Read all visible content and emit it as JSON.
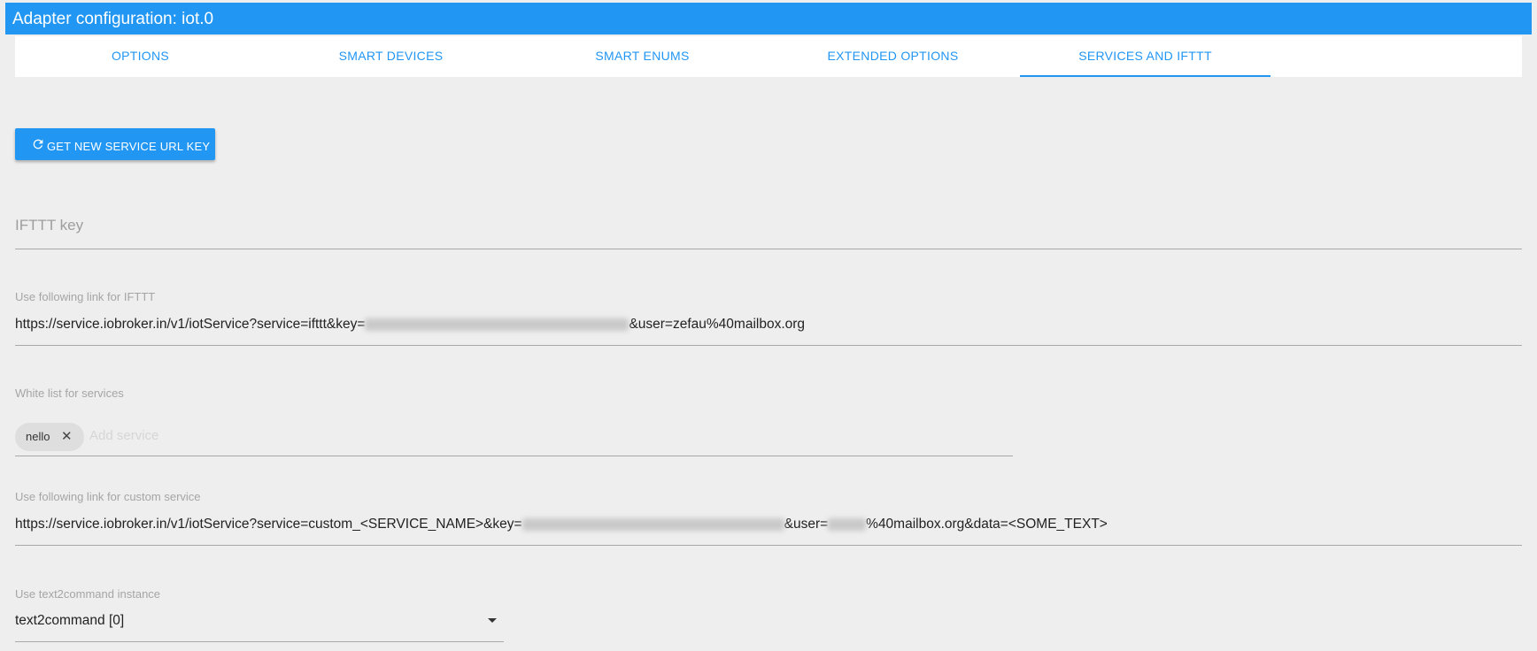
{
  "window": {
    "title": "Adapter configuration: iot.0"
  },
  "tabs": [
    {
      "label": "OPTIONS"
    },
    {
      "label": "SMART DEVICES"
    },
    {
      "label": "SMART ENUMS"
    },
    {
      "label": "EXTENDED OPTIONS"
    },
    {
      "label": "SERVICES AND IFTTT",
      "active": true
    }
  ],
  "refresh_button": {
    "label": "GET NEW SERVICE URL KEY",
    "icon": "refresh-icon"
  },
  "ifttt_key": {
    "placeholder": "IFTTT key",
    "value": ""
  },
  "ifttt_link": {
    "label": "Use following link for IFTTT",
    "prefix": "https://service.iobroker.in/v1/iotService?service=ifttt&key=",
    "suffix": "&user=zefau%40mailbox.org"
  },
  "white_list": {
    "label": "White list for services",
    "chips": [
      "nello"
    ],
    "placeholder": "Add service"
  },
  "custom_link": {
    "label": "Use following link for custom service",
    "prefix": "https://service.iobroker.in/v1/iotService?service=custom_<SERVICE_NAME>&key=",
    "middle": "&user=",
    "suffix": "%40mailbox.org&data=<SOME_TEXT>"
  },
  "text2command": {
    "label": "Use text2command instance",
    "value": "text2command [0]"
  },
  "colors": {
    "accent": "#2196f3",
    "background": "#eeeeee"
  }
}
